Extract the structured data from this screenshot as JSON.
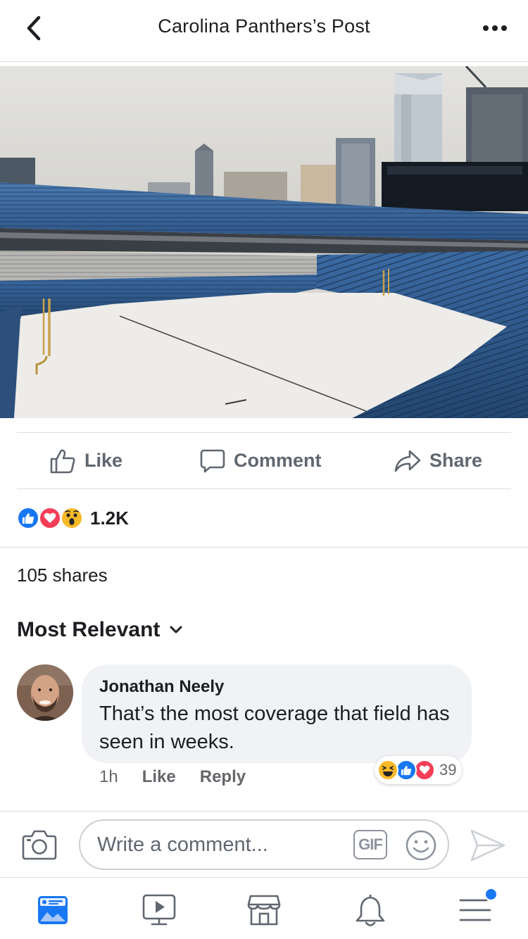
{
  "header": {
    "title": "Carolina Panthers’s Post",
    "back_icon": "chevron-left-icon",
    "more_icon": "more-horizontal-icon"
  },
  "photo": {
    "subject": "snow-covered-stadium"
  },
  "actions": {
    "like_label": "Like",
    "comment_label": "Comment",
    "share_label": "Share"
  },
  "reactions": {
    "types": [
      "like",
      "love",
      "wow"
    ],
    "count": "1.2K"
  },
  "shares": "105 shares",
  "sort": {
    "label": "Most Relevant"
  },
  "comment": {
    "author": "Jonathan Neely",
    "text": "That’s the most coverage that field has seen in weeks.",
    "time": "1h",
    "like_label": "Like",
    "reply_label": "Reply",
    "reaction_types": [
      "haha",
      "like",
      "love"
    ],
    "reaction_count": "39"
  },
  "composer": {
    "placeholder": "Write a comment...",
    "gif_label": "GIF"
  },
  "nav": {
    "items": [
      "news-feed",
      "watch",
      "marketplace",
      "notifications",
      "menu"
    ],
    "active": "news-feed",
    "badge_on": "menu"
  },
  "colors": {
    "accent": "#1877f2",
    "love": "#f33e58",
    "wow": "#f7b928",
    "secondary_text": "#606770",
    "divider": "#dadde1"
  }
}
